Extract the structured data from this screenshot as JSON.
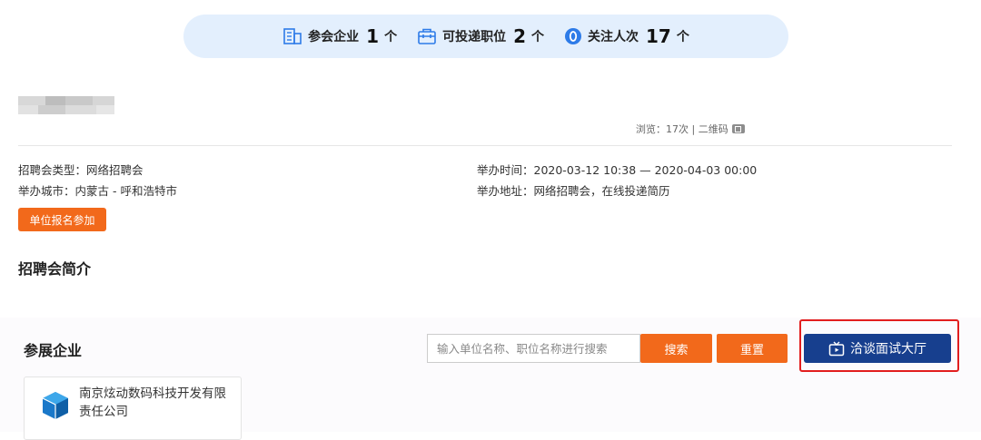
{
  "stats": {
    "companies": {
      "label": "参会企业",
      "count": "1",
      "unit": "个",
      "icon": "building-icon"
    },
    "positions": {
      "label": "可投递职位",
      "count": "2",
      "unit": "个",
      "icon": "briefcase-icon"
    },
    "followers": {
      "label": "关注人次",
      "count": "17",
      "unit": "个",
      "icon": "eye-icon"
    }
  },
  "views": {
    "text": "浏览：17次 | 二维码"
  },
  "info": {
    "fair_type": "招聘会类型：网络招聘会",
    "city": "举办城市：内蒙古 - 呼和浩特市",
    "time": "举办时间：2020-03-12 10:38 — 2020-04-03 00:00",
    "address": "举办地址：网络招聘会，在线投递简历"
  },
  "signup_button": "单位报名参加",
  "intro_title": "招聘会简介",
  "exhibitors": {
    "title": "参展企业",
    "search_placeholder": "输入单位名称、职位名称进行搜索",
    "search_button": "搜索",
    "reset_button": "重置",
    "hall_button": "洽谈面试大厅"
  },
  "companies": [
    {
      "name": "南京炫动数码科技开发有限责任公司"
    }
  ],
  "colors": {
    "accent_orange": "#f2691b",
    "navy": "#173f8e",
    "stats_bg": "#e3effd",
    "highlight_red": "#e21e1e",
    "icon_blue": "#2d7be8"
  }
}
